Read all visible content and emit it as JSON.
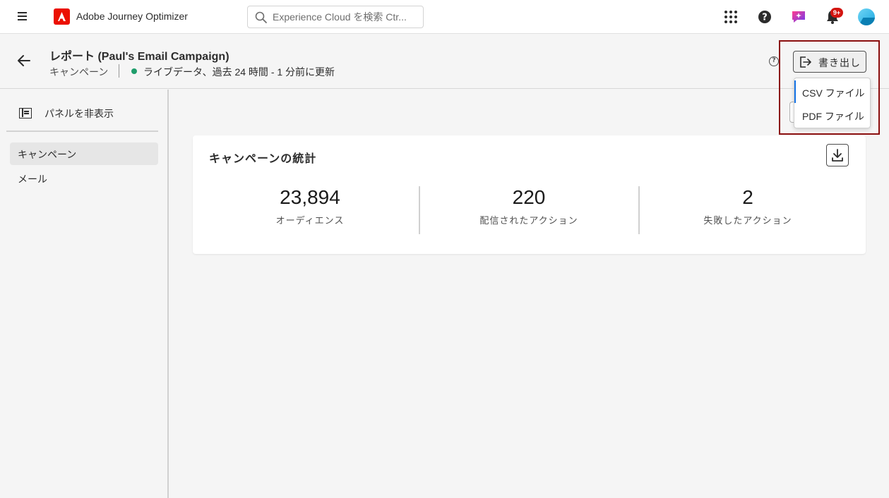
{
  "app": {
    "title": "Adobe Journey Optimizer"
  },
  "search": {
    "placeholder": "Experience Cloud を検索 Ctr..."
  },
  "notifications": {
    "badge": "9+"
  },
  "header": {
    "title": "レポート (Paul's Email Campaign)",
    "subtitle": "キャンペーン",
    "status": "ライブデータ、過去 24 時間 - 1 分前に更新"
  },
  "export": {
    "button_label": "書き出し",
    "menu": [
      "CSV ファイル",
      "PDF ファイル"
    ]
  },
  "sidebar": {
    "toggle_label": "パネルを非表示",
    "items": [
      {
        "label": "キャンペーン",
        "active": true
      },
      {
        "label": "メール",
        "active": false
      }
    ]
  },
  "card": {
    "title": "キャンペーンの統計",
    "stats": [
      {
        "value": "23,894",
        "label": "オーディエンス"
      },
      {
        "value": "220",
        "label": "配信されたアクション"
      },
      {
        "value": "2",
        "label": "失敗したアクション"
      }
    ]
  },
  "colors": {
    "brand": "#eb1000",
    "status_live": "#1f9d6b",
    "highlight": "#8b0f0f",
    "focus": "#1473e6"
  }
}
